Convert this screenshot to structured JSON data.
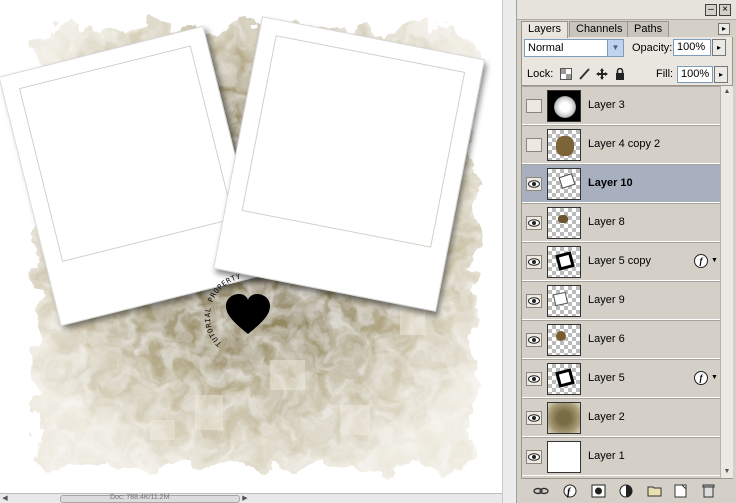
{
  "panel": {
    "tabs": [
      "Layers",
      "Channels",
      "Paths"
    ],
    "blend_mode": "Normal",
    "opacity_label": "Opacity:",
    "opacity_value": "100%",
    "lock_label": "Lock:",
    "fill_label": "Fill:",
    "fill_value": "100%",
    "minimize_icon": "minimize-icon",
    "close_icon": "close-icon"
  },
  "layers": [
    {
      "name": "Layer 3",
      "visible": false,
      "selected": false,
      "fx": false,
      "thumb": "white-blur"
    },
    {
      "name": "Layer 4 copy 2",
      "visible": false,
      "selected": false,
      "fx": false,
      "thumb": "brown-flower"
    },
    {
      "name": "Layer 10",
      "visible": true,
      "selected": true,
      "fx": false,
      "thumb": "white-square-tilt"
    },
    {
      "name": "Layer 8",
      "visible": true,
      "selected": false,
      "fx": false,
      "thumb": "brown-small"
    },
    {
      "name": "Layer 5 copy",
      "visible": true,
      "selected": false,
      "fx": true,
      "thumb": "black-square-tilt"
    },
    {
      "name": "Layer 9",
      "visible": true,
      "selected": false,
      "fx": false,
      "thumb": "white-square"
    },
    {
      "name": "Layer 6",
      "visible": true,
      "selected": false,
      "fx": false,
      "thumb": "brown-dot"
    },
    {
      "name": "Layer 5",
      "visible": true,
      "selected": false,
      "fx": true,
      "thumb": "black-square-tilt"
    },
    {
      "name": "Layer 2",
      "visible": true,
      "selected": false,
      "fx": false,
      "thumb": "olive-fill"
    },
    {
      "name": "Layer 1",
      "visible": true,
      "selected": false,
      "fx": false,
      "thumb": "white-fill"
    }
  ],
  "fx_label": "f",
  "canvas": {
    "watermark_text": "TUTORIAL PROPERTY OF GRAPHICSADDICT.COM",
    "status_text": "Doc: 788.4K/11.2M",
    "colors": {
      "olive": "#8e8055",
      "dark_olive": "#6b603c"
    }
  },
  "bottom_icons": [
    "link-layers-icon",
    "add-style-icon",
    "add-mask-icon",
    "adjustment-layer-icon",
    "new-group-icon",
    "new-layer-icon",
    "delete-layer-icon"
  ]
}
